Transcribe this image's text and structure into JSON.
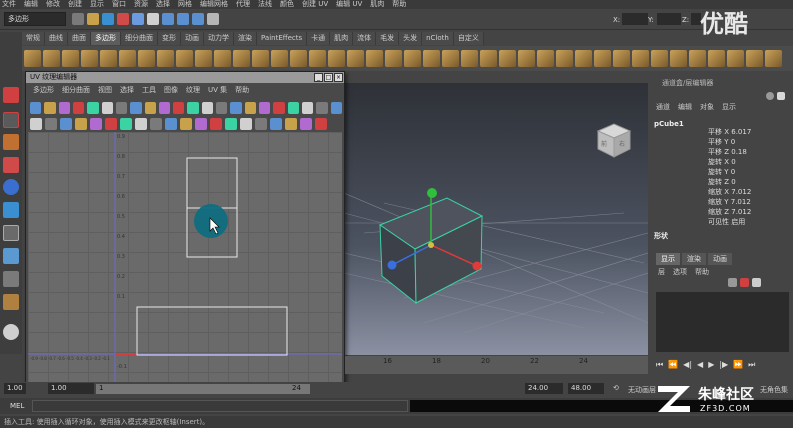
{
  "menubar": [
    "文件",
    "编辑",
    "修改",
    "创建",
    "显示",
    "窗口",
    "资源",
    "选择",
    "网格",
    "编辑网格",
    "代理",
    "法线",
    "颜色",
    "创建 UV",
    "编辑 UV",
    "肌肉",
    "帮助"
  ],
  "status": {
    "mode": "多边形",
    "x_label": "X:",
    "y_label": "Y:",
    "z_label": "Z:"
  },
  "shelf_tabs": [
    "常规",
    "曲线",
    "曲面",
    "多边形",
    "细分曲面",
    "变形",
    "动画",
    "动力学",
    "渲染",
    "PaintEffects",
    "卡通",
    "肌肉",
    "流体",
    "毛发",
    "头发",
    "nCloth",
    "自定义"
  ],
  "shelf_active": "多边形",
  "uv_editor": {
    "title": "UV 纹理编辑器",
    "menus": [
      "多边形",
      "细分曲面",
      "视图",
      "选择",
      "工具",
      "图像",
      "纹理",
      "UV 集",
      "帮助"
    ],
    "v_ticks": [
      "0.9",
      "0.8",
      "0.7",
      "0.6",
      "0.5",
      "0.4",
      "0.3",
      "0.2",
      "0.1",
      "-0.1"
    ],
    "h_ticks": [
      "-0.9",
      "-0.8",
      "-0.7",
      "-0.6",
      "-0.5",
      "-0.4",
      "-0.3",
      "-0.2",
      "-0.1"
    ]
  },
  "channel_box": {
    "title": "通道盒/层编辑器",
    "tabs": [
      "通道",
      "编辑",
      "对象",
      "显示"
    ],
    "object": "pCube1",
    "attrs": [
      {
        "label": "平移 X",
        "value": "6.017"
      },
      {
        "label": "平移 Y",
        "value": "0"
      },
      {
        "label": "平移 Z",
        "value": "0.18"
      },
      {
        "label": "旋转 X",
        "value": "0"
      },
      {
        "label": "旋转 Y",
        "value": "0"
      },
      {
        "label": "旋转 Z",
        "value": "0"
      },
      {
        "label": "缩放 X",
        "value": "7.012"
      },
      {
        "label": "缩放 Y",
        "value": "7.012"
      },
      {
        "label": "缩放 Z",
        "value": "7.012"
      },
      {
        "label": "可见性",
        "value": "启用"
      }
    ],
    "shapes_header": "形状",
    "layer_tabs": [
      "显示",
      "渲染",
      "动画"
    ],
    "layer_menu": [
      "层",
      "选项",
      "帮助"
    ]
  },
  "viewport": {
    "cube_labels": [
      "前",
      "右"
    ]
  },
  "timeline": {
    "ticks": [
      "16",
      "18",
      "20",
      "22",
      "24"
    ]
  },
  "range": {
    "start": "1.00",
    "start2": "1.00",
    "current": "1",
    "end_field": "24",
    "end": "24.00",
    "total": "48.00",
    "anim_layer": "无动画层",
    "char_set": "无角色集"
  },
  "mel": {
    "label": "MEL"
  },
  "help": "插入工具: 使用插入循环对象，使用插入模式来更改枢轴(Insert)。",
  "watermarks": {
    "top": "优酷",
    "brand": "朱峰社区",
    "domain": "ZF3D.COM"
  }
}
